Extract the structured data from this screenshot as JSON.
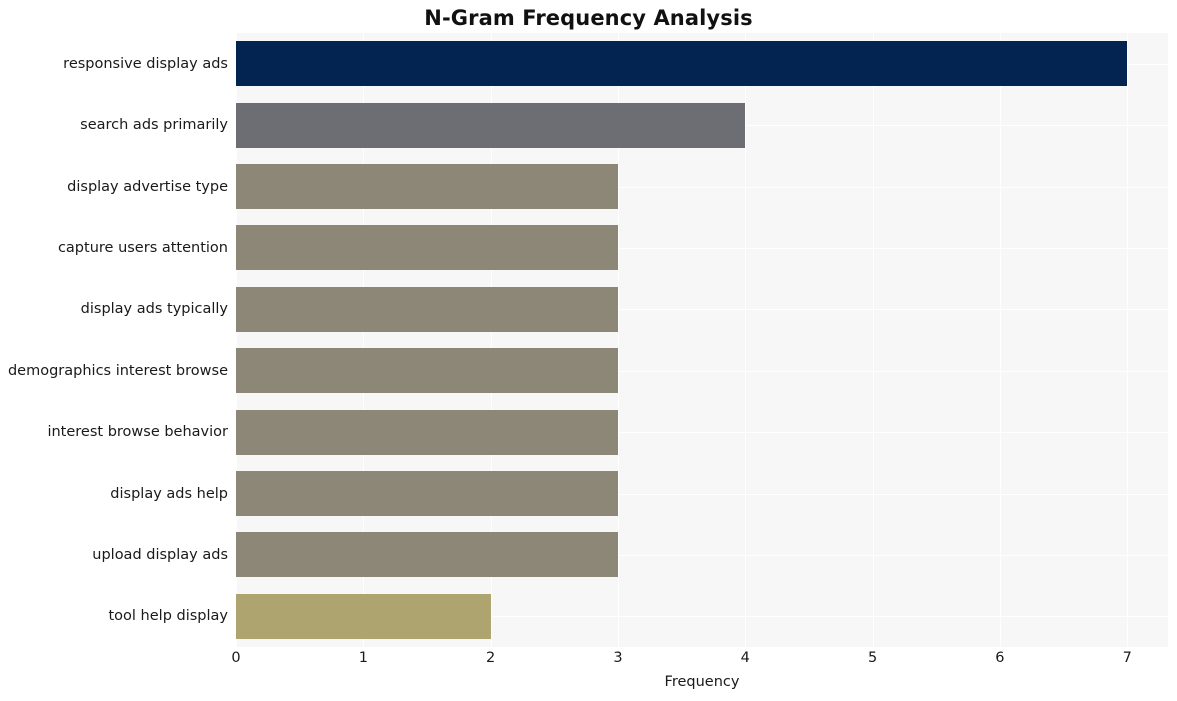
{
  "chart_data": {
    "type": "bar",
    "orientation": "horizontal",
    "title": "N-Gram Frequency Analysis",
    "xlabel": "Frequency",
    "ylabel": "",
    "categories": [
      "responsive display ads",
      "search ads primarily",
      "display advertise type",
      "capture users attention",
      "display ads typically",
      "demographics interest browse",
      "interest browse behavior",
      "display ads help",
      "upload display ads",
      "tool help display"
    ],
    "values": [
      7,
      4,
      3,
      3,
      3,
      3,
      3,
      3,
      3,
      2
    ],
    "bar_colors": [
      "#032450",
      "#6d6e73",
      "#8d8778",
      "#8d8778",
      "#8d8778",
      "#8d8778",
      "#8d8778",
      "#8d8778",
      "#8d8778",
      "#aea46f"
    ],
    "xlim": [
      0,
      7.32
    ],
    "xticks": [
      0,
      1,
      2,
      3,
      4,
      5,
      6,
      7
    ],
    "xtick_labels": [
      "0",
      "1",
      "2",
      "3",
      "4",
      "5",
      "6",
      "7"
    ],
    "grid": true,
    "grid_color": "#ffffff",
    "plot_background": "#f7f7f7",
    "figure_background": "#ffffff",
    "legend": null
  }
}
